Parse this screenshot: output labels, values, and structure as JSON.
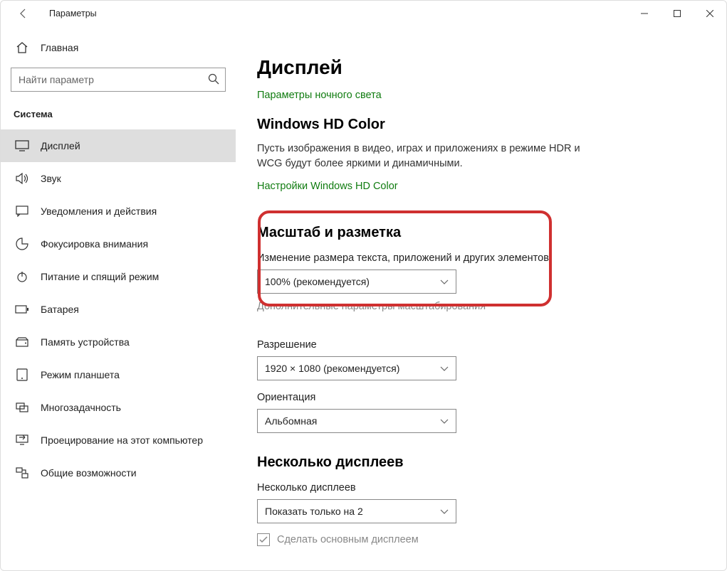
{
  "titlebar": {
    "app_title": "Параметры"
  },
  "sidebar": {
    "home": "Главная",
    "search_placeholder": "Найти параметр",
    "category": "Система",
    "items": [
      {
        "icon": "display",
        "label": "Дисплей"
      },
      {
        "icon": "sound",
        "label": "Звук"
      },
      {
        "icon": "notif",
        "label": "Уведомления и действия"
      },
      {
        "icon": "focus",
        "label": "Фокусировка внимания"
      },
      {
        "icon": "power",
        "label": "Питание и спящий режим"
      },
      {
        "icon": "battery",
        "label": "Батарея"
      },
      {
        "icon": "storage",
        "label": "Память устройства"
      },
      {
        "icon": "tablet",
        "label": "Режим планшета"
      },
      {
        "icon": "multitask",
        "label": "Многозадачность"
      },
      {
        "icon": "project",
        "label": "Проецирование на этот компьютер"
      },
      {
        "icon": "shared",
        "label": "Общие возможности"
      }
    ]
  },
  "content": {
    "page_title": "Дисплей",
    "night_link": "Параметры ночного света",
    "hd_heading": "Windows HD Color",
    "hd_body": "Пусть изображения в видео, играх и приложениях в режиме HDR и WCG будут более яркими и динамичными.",
    "hd_link": "Настройки Windows HD Color",
    "scale_heading": "Масштаб и разметка",
    "scale_label": "Изменение размера текста, приложений и других элементов",
    "scale_value": "100% (рекомендуется)",
    "scale_adv": "Дополнительные параметры масштабирования",
    "res_label": "Разрешение",
    "res_value": "1920 × 1080 (рекомендуется)",
    "orient_label": "Ориентация",
    "orient_value": "Альбомная",
    "multi_heading": "Несколько дисплеев",
    "multi_label": "Несколько дисплеев",
    "multi_value": "Показать только на 2",
    "primary_check": "Сделать основным дисплеем"
  }
}
